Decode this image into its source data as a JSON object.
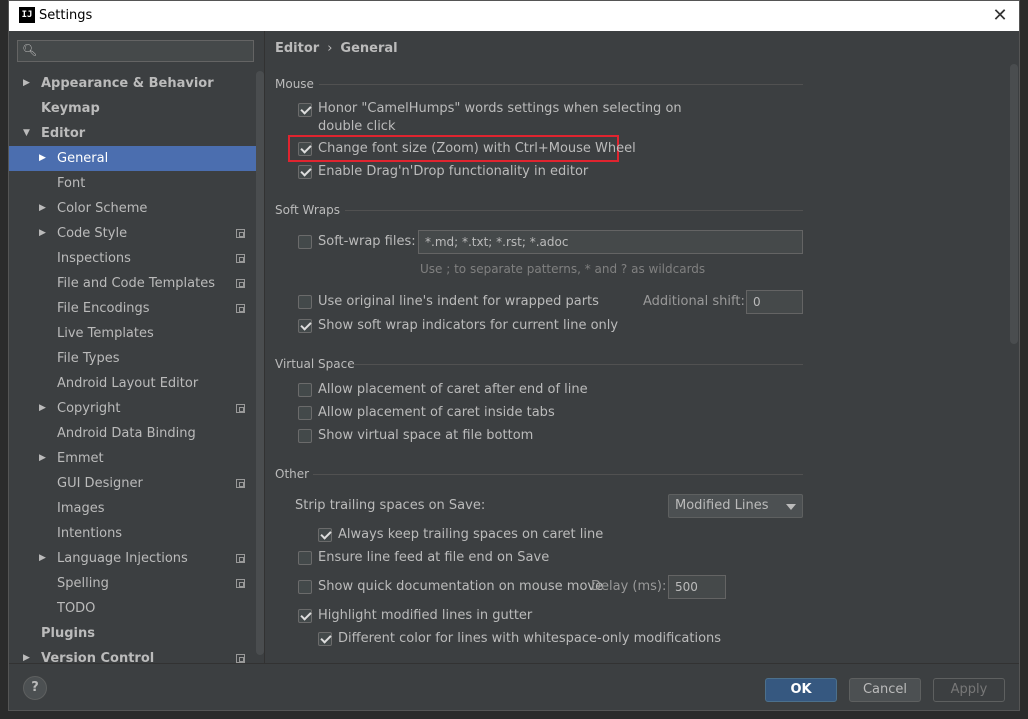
{
  "window": {
    "title": "Settings",
    "app_icon_text": "IJ"
  },
  "search": {
    "placeholder": ""
  },
  "tree": [
    {
      "label": "Appearance & Behavior",
      "bold": true,
      "arrow": "right",
      "level": 0
    },
    {
      "label": "Keymap",
      "bold": true,
      "arrow": "",
      "level": 0
    },
    {
      "label": "Editor",
      "bold": true,
      "arrow": "down",
      "level": 0
    },
    {
      "label": "General",
      "bold": false,
      "arrow": "right",
      "level": 1,
      "selected": true
    },
    {
      "label": "Font",
      "level": 1
    },
    {
      "label": "Color Scheme",
      "arrow": "right",
      "level": 1
    },
    {
      "label": "Code Style",
      "arrow": "right",
      "level": 1,
      "project": true
    },
    {
      "label": "Inspections",
      "level": 1,
      "project": true
    },
    {
      "label": "File and Code Templates",
      "level": 1,
      "project": true
    },
    {
      "label": "File Encodings",
      "level": 1,
      "project": true
    },
    {
      "label": "Live Templates",
      "level": 1
    },
    {
      "label": "File Types",
      "level": 1
    },
    {
      "label": "Android Layout Editor",
      "level": 1
    },
    {
      "label": "Copyright",
      "arrow": "right",
      "level": 1,
      "project": true
    },
    {
      "label": "Android Data Binding",
      "level": 1
    },
    {
      "label": "Emmet",
      "arrow": "right",
      "level": 1
    },
    {
      "label": "GUI Designer",
      "level": 1,
      "project": true
    },
    {
      "label": "Images",
      "level": 1
    },
    {
      "label": "Intentions",
      "level": 1
    },
    {
      "label": "Language Injections",
      "arrow": "right",
      "level": 1,
      "project": true
    },
    {
      "label": "Spelling",
      "level": 1,
      "project": true
    },
    {
      "label": "TODO",
      "level": 1
    },
    {
      "label": "Plugins",
      "bold": true,
      "level": 0
    },
    {
      "label": "Version Control",
      "bold": true,
      "arrow": "right",
      "level": 0,
      "project": true
    }
  ],
  "breadcrumb": {
    "parent": "Editor",
    "separator": "›",
    "current": "General"
  },
  "mouse": {
    "title": "Mouse",
    "camelhumps_line1": "Honor \"CamelHumps\" words settings when selecting on",
    "camelhumps_line2": "double click",
    "zoom": "Change font size (Zoom) with Ctrl+Mouse Wheel",
    "dragdrop": "Enable Drag'n'Drop functionality in editor"
  },
  "softwraps": {
    "title": "Soft Wraps",
    "files_label": "Soft-wrap files:",
    "files_value": "*.md; *.txt; *.rst; *.adoc",
    "hint": "Use ; to separate patterns, * and ? as wildcards",
    "indent": "Use original line's indent for wrapped parts",
    "shift_label": "Additional shift:",
    "shift_value": "0",
    "indicators": "Show soft wrap indicators for current line only"
  },
  "virtual": {
    "title": "Virtual Space",
    "after_end": "Allow placement of caret after end of line",
    "inside_tabs": "Allow placement of caret inside tabs",
    "file_bottom": "Show virtual space at file bottom"
  },
  "other": {
    "title": "Other",
    "strip_label": "Strip trailing spaces on Save:",
    "strip_value": "Modified Lines",
    "keep_trailing": "Always keep trailing spaces on caret line",
    "line_feed": "Ensure line feed at file end on Save",
    "quick_doc": "Show quick documentation on mouse move",
    "delay_label": "Delay (ms):",
    "delay_value": "500",
    "highlight_modified": "Highlight modified lines in gutter",
    "diff_color": "Different color for lines with whitespace-only modifications"
  },
  "buttons": {
    "help": "?",
    "ok": "OK",
    "cancel": "Cancel",
    "apply": "Apply"
  },
  "colors": {
    "accent": "#4b6eaf",
    "highlight_box": "#e0242f",
    "ok_button": "#365880"
  }
}
